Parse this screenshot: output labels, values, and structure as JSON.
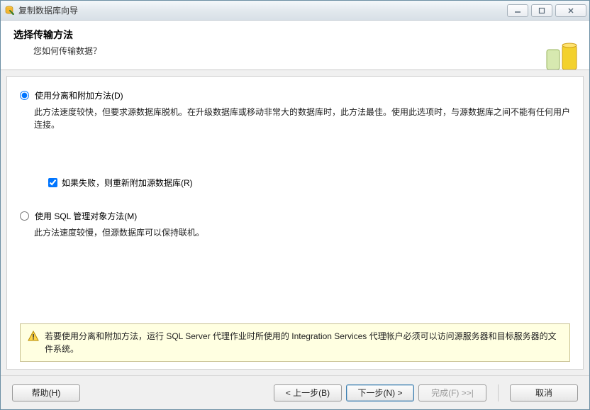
{
  "window": {
    "title": "复制数据库向导"
  },
  "header": {
    "title": "选择传输方法",
    "subtitle": "您如何传输数据？"
  },
  "options": {
    "opt1": {
      "label": "使用分离和附加方法(D)",
      "desc": "此方法速度较快，但要求源数据库脱机。在升级数据库或移动非常大的数据库时，此方法最佳。使用此选项时，与源数据库之间不能有任何用户连接。"
    },
    "reattach": {
      "label": "如果失败，则重新附加源数据库(R)"
    },
    "opt2": {
      "label": "使用 SQL 管理对象方法(M)",
      "desc": "此方法速度较慢，但源数据库可以保持联机。"
    }
  },
  "warning": {
    "text": "若要使用分离和附加方法，运行 SQL Server 代理作业时所使用的 Integration Services 代理帐户必须可以访问源服务器和目标服务器的文件系统。"
  },
  "buttons": {
    "help": "帮助(H)",
    "back": "< 上一步(B)",
    "next": "下一步(N) >",
    "finish": "完成(F) >>|",
    "cancel": "取消"
  }
}
